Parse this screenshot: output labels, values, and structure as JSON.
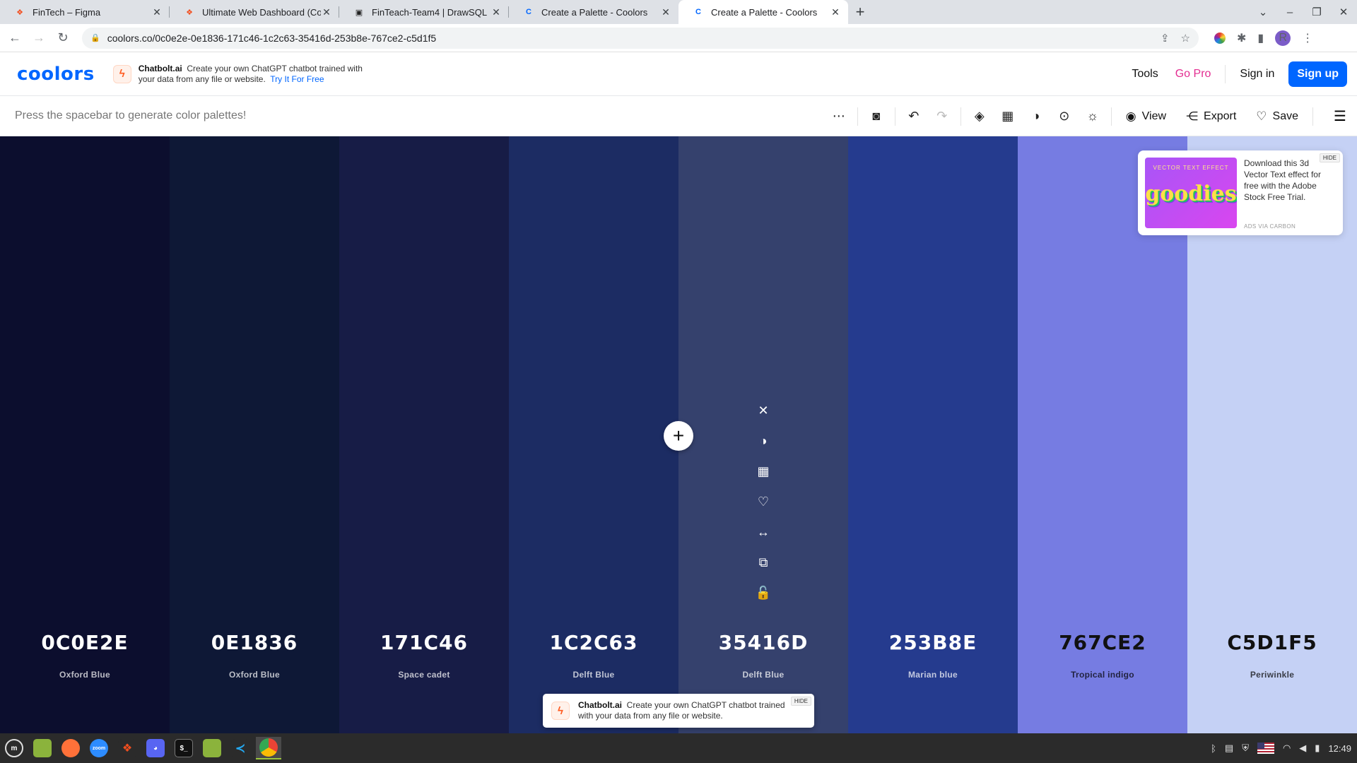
{
  "browser": {
    "tabs": [
      {
        "title": "FinTech – Figma",
        "icon": "figma-icon",
        "color": "#f24e1e"
      },
      {
        "title": "Ultimate Web Dashboard (Co",
        "icon": "figma-icon",
        "color": "#f24e1e"
      },
      {
        "title": "FinTeach-Team4 | DrawSQL",
        "icon": "drawsql-icon",
        "color": "#222222"
      },
      {
        "title": "Create a Palette - Coolors",
        "icon": "coolors-icon",
        "color": "#0066ff"
      },
      {
        "title": "Create a Palette - Coolors",
        "icon": "coolors-icon",
        "color": "#0066ff",
        "active": true
      }
    ],
    "url": "coolors.co/0c0e2e-0e1836-171c46-1c2c63-35416d-253b8e-767ce2-c5d1f5",
    "profile_initial": "R"
  },
  "header": {
    "logo": "coolors",
    "promo": {
      "brand": "Chatbolt.ai",
      "text": "Create your own ChatGPT chatbot trained with your data from any file or website.",
      "link": "Try It For Free"
    },
    "nav": {
      "tools": "Tools",
      "go_pro": "Go Pro",
      "sign_in": "Sign in",
      "sign_up": "Sign up"
    }
  },
  "toolbar": {
    "hint": "Press the spacebar to generate color palettes!",
    "view": "View",
    "export": "Export",
    "save": "Save"
  },
  "palette": [
    {
      "hex": "0C0E2E",
      "name": "Oxford Blue",
      "color": "#0c0e2e",
      "tone": "dark"
    },
    {
      "hex": "0E1836",
      "name": "Oxford Blue",
      "color": "#0e1836",
      "tone": "dark"
    },
    {
      "hex": "171C46",
      "name": "Space cadet",
      "color": "#171c46",
      "tone": "dark"
    },
    {
      "hex": "1C2C63",
      "name": "Delft Blue",
      "color": "#1c2c63",
      "tone": "dark"
    },
    {
      "hex": "35416D",
      "name": "Delft Blue",
      "color": "#35416d",
      "tone": "dark"
    },
    {
      "hex": "253B8E",
      "name": "Marian blue",
      "color": "#253b8e",
      "tone": "dark"
    },
    {
      "hex": "767CE2",
      "name": "Tropical indigo",
      "color": "#767ce2",
      "tone": "light"
    },
    {
      "hex": "C5D1F5",
      "name": "Periwinkle",
      "color": "#c5d1f5",
      "tone": "light"
    }
  ],
  "carbon_ad": {
    "image_caption": "VECTOR TEXT EFFECT",
    "image_word": "goodies",
    "text": "Download this 3d Vector Text effect for free with the Adobe Stock Free Trial.",
    "via": "ADS VIA CARBON",
    "hide": "HIDE"
  },
  "bottom_promo": {
    "brand": "Chatbolt.ai",
    "text": "Create your own ChatGPT chatbot trained with your data from any file or website.",
    "hide": "HIDE"
  },
  "taskbar": {
    "clock": "12:49"
  }
}
